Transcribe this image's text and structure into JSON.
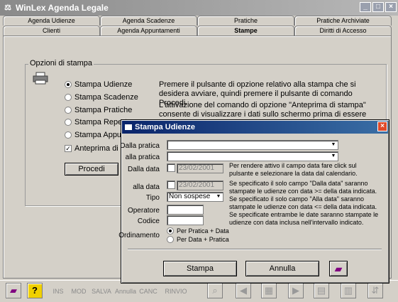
{
  "window": {
    "title": "WinLex Agenda Legale"
  },
  "tabs_row1": [
    "Agenda Udienze",
    "Agenda Scadenze",
    "Pratiche",
    "Pratiche Archiviate"
  ],
  "tabs_row2": [
    "Clienti",
    "Agenda Appuntamenti",
    "Stampe",
    "Diritti di Accesso"
  ],
  "group": {
    "title": "Opzioni di stampa",
    "options": [
      {
        "label": "Stampa Udienze",
        "selected": true
      },
      {
        "label": "Stampa Scadenze",
        "selected": false
      },
      {
        "label": "Stampa Pratiche",
        "selected": false
      },
      {
        "label": "Stampa Reperto",
        "selected": false
      },
      {
        "label": "Stampa Appunt",
        "selected": false
      }
    ],
    "preview_label": "Anteprima di st",
    "procedi": "Procedi",
    "desc1": "Premere il pulsante di opzione relativo alla stampa che si desidera avviare, quindi premere il pulsante di comando Procedi.",
    "desc2": "L'attivazione del comando di opzione \"Anteprima di stampa\" consente di visualizzare i dati sullo schermo prima di essere"
  },
  "toolbar": [
    "INS",
    "MOD",
    "SALVA",
    "Annulla",
    "CANC",
    "RINVIO"
  ],
  "dialog": {
    "title": "Stampa Udienze",
    "dalla_pratica": "Dalla pratica",
    "alla_pratica": "alla pratica",
    "dalla_data": "Dalla data",
    "alla_data": "alla data",
    "date_value": "23/02/2001",
    "tipo": "Tipo",
    "tipo_value": "Non sospese",
    "operatore": "Operatore",
    "codice": "Codice",
    "ordinamento": "Ordinamento",
    "ord_options": [
      {
        "label": "Per Pratica + Data",
        "selected": true
      },
      {
        "label": "Per Data + Pratica",
        "selected": false
      }
    ],
    "note1": "Per rendere attivo il campo data fare click sul pulsante e selezionare la data dal calendario.",
    "note2": "Se specificato il solo campo \"Dalla data\" saranno stampate le udienze con data >= della data indicata. Se specificato il solo campo \"Alla data\" saranno stampate le udienze con data <= della data  indicata. Se specificate entrambe le date saranno stampate le udienze con data inclusa nell'intervallo indicato.",
    "stampa": "Stampa",
    "annulla": "Annulla"
  }
}
